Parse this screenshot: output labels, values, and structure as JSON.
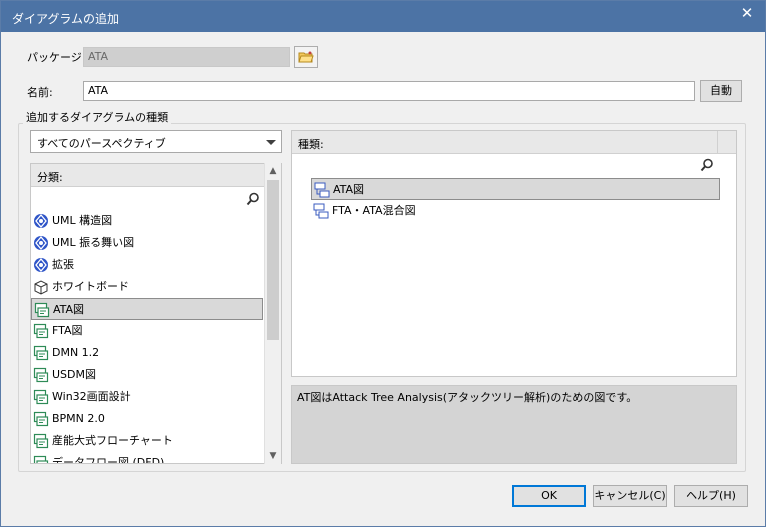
{
  "window": {
    "title": "ダイアグラムの追加",
    "close_glyph": "✕"
  },
  "package": {
    "label": "パッケージ:",
    "value": "ATA"
  },
  "name": {
    "label": "名前:",
    "value": "ATA",
    "auto_button": "自動"
  },
  "group": {
    "title": "追加するダイアグラムの種類"
  },
  "perspective": {
    "selected": "すべてのパースペクティブ"
  },
  "category": {
    "header": "分類:",
    "items": [
      {
        "label": "UML 構造図",
        "icon": "uml-structure-icon"
      },
      {
        "label": "UML 振る舞い図",
        "icon": "uml-behavior-icon"
      },
      {
        "label": "拡張",
        "icon": "extension-icon"
      },
      {
        "label": "ホワイトボード",
        "icon": "whiteboard-icon"
      },
      {
        "label": "ATA図",
        "icon": "ata-diagram-icon"
      },
      {
        "label": "FTA図",
        "icon": "fta-diagram-icon"
      },
      {
        "label": "DMN 1.2",
        "icon": "dmn-icon"
      },
      {
        "label": "USDM図",
        "icon": "usdm-icon"
      },
      {
        "label": "Win32画面設計",
        "icon": "win32-icon"
      },
      {
        "label": "BPMN 2.0",
        "icon": "bpmn-icon"
      },
      {
        "label": "産能大式フローチャート",
        "icon": "flowchart-icon"
      },
      {
        "label": "データフロー図 (DFD)",
        "icon": "dfd-icon"
      }
    ],
    "selected_index": 4
  },
  "types": {
    "header": "種類:",
    "items": [
      {
        "label": "ATA図",
        "icon": "ata-type-icon"
      },
      {
        "label": "FTA・ATA混合図",
        "icon": "fta-ata-type-icon"
      }
    ],
    "selected_index": 0
  },
  "description": "AT図はAttack Tree Analysis(アタックツリー解析)のための図です。",
  "buttons": {
    "ok": "OK",
    "cancel": "キャンセル(C)",
    "help": "ヘルプ(H)"
  },
  "colors": {
    "titlebar": "#4c73a5",
    "uml_icon": "#2f55c8",
    "diagram_icon": "#2e8b57"
  }
}
